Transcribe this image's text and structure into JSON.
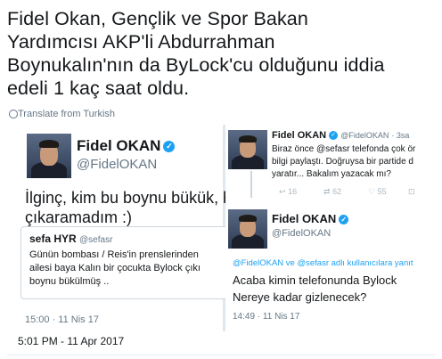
{
  "tweet": {
    "text": "Fidel Okan, Gençlik ve Spor Bakan\nYardımcısı AKP'li Abdurrahman\nBoynukalın'nın da ByLock'cu olduğunu iddia\nedeli 1 kaç saat oldu.",
    "translate_label": "Translate from Turkish",
    "datetime": "5:01 PM - 11 Apr 2017"
  },
  "left_card": {
    "name": "Fidel OKAN",
    "handle": "@FidelOKAN",
    "text_line1": "İlginç, kim bu boynu bükük, b",
    "text_line2": "çıkaramadım :)",
    "quote": {
      "name": "sefa HYR",
      "handle": "@sefasr",
      "line1": "Günün bombası / Reis'in prenslerinden",
      "line2": "ailesi baya Kalın bir çocukta Bylock çıkı",
      "line3": "boynu bükülmüş .."
    },
    "timestamp": "15:00 · 11 Nis 17"
  },
  "right_card": {
    "top_tweet": {
      "name": "Fidel OKAN",
      "handle": "@FidelOKAN",
      "time": "· 3sa",
      "line1": "Biraz önce @sefasr telefonda çok ör",
      "line2": "bilgi paylaştı. Doğruysa bir partide d",
      "line3": "yaratır... Bakalım yazacak mı?",
      "reply_count": "16",
      "retweet_count": "62",
      "like_count": "55"
    },
    "reply": {
      "name": "Fidel OKAN",
      "handle": "@FidelOKAN",
      "replying_to": "@FidelOKAN ve @sefasr adlı kullanıcılara yanıt",
      "line1": "Acaba kimin telefonunda Bylock",
      "line2": "Nereye kadar gizlenecek?",
      "timestamp": "14:49 · 11 Nis 17"
    }
  },
  "icons": {
    "verified": "verified-badge-icon",
    "globe": "globe-icon",
    "reply": "reply-icon",
    "retweet": "retweet-icon",
    "like": "heart-icon"
  },
  "colors": {
    "text": "#14171a",
    "secondary": "#657786",
    "verified": "#1da1f2",
    "link": "#1da1f2"
  }
}
